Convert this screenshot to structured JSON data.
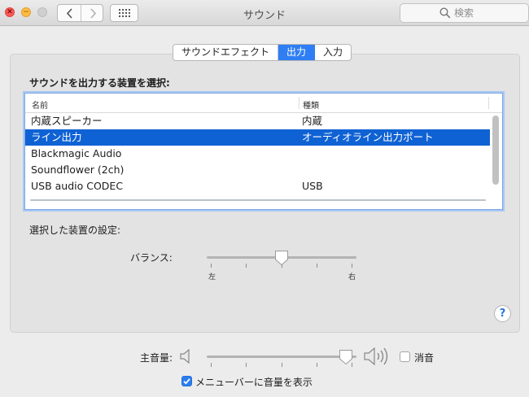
{
  "window": {
    "title": "サウンド",
    "search_placeholder": "検索"
  },
  "tabs": [
    {
      "label": "サウンドエフェクト",
      "active": false
    },
    {
      "label": "出力",
      "active": true
    },
    {
      "label": "入力",
      "active": false
    }
  ],
  "output": {
    "section_title": "サウンドを出力する装置を選択:",
    "columns": {
      "name": "名前",
      "type": "種類"
    },
    "devices": [
      {
        "name": "内蔵スピーカー",
        "type": "内蔵",
        "selected": false
      },
      {
        "name": "ライン出力",
        "type": "オーディオライン出力ポート",
        "selected": true
      },
      {
        "name": "Blackmagic Audio",
        "type": "",
        "selected": false
      },
      {
        "name": "Soundflower (2ch)",
        "type": "",
        "selected": false
      },
      {
        "name": "USB audio CODEC",
        "type": "USB",
        "selected": false
      }
    ],
    "settings_title": "選択した装置の設定:",
    "balance": {
      "label": "バランス:",
      "left_label": "左",
      "right_label": "右",
      "value": 0.5
    }
  },
  "help_label": "?",
  "volume": {
    "label": "主音量:",
    "value": 0.96,
    "mute_label": "消音",
    "mute_checked": false,
    "show_in_menubar_label": "メニューバーに音量を表示",
    "show_in_menubar_checked": true
  },
  "colors": {
    "accent": "#2f7ef4",
    "selection": "#0f62d4",
    "close": "#fc5753",
    "minimize": "#fdbc40"
  },
  "icons": [
    "close-icon",
    "minimize-icon",
    "chevron-left-icon",
    "chevron-right-icon",
    "grid-icon",
    "search-icon",
    "speaker-low-icon",
    "speaker-high-icon",
    "checkmark-icon",
    "question-icon"
  ]
}
